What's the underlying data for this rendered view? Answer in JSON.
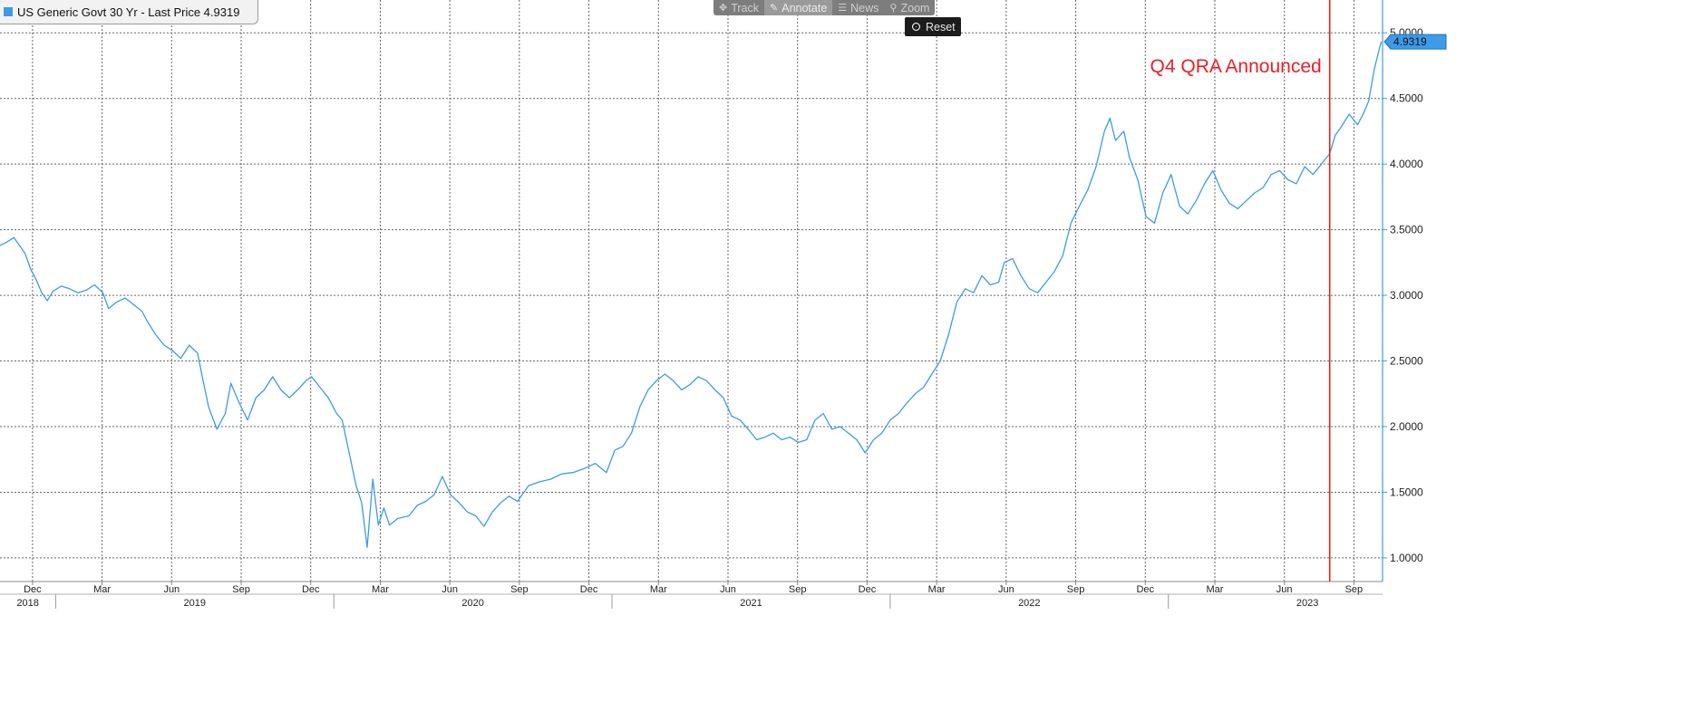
{
  "legend": {
    "label": "US Generic Govt 30 Yr - Last Price 4.9319",
    "swatch_color": "#3d9be8"
  },
  "toolbar": {
    "track_label": "Track",
    "annotate_label": "Annotate",
    "news_label": "News",
    "zoom_label": "Zoom",
    "reset_label": "Reset"
  },
  "annotation": {
    "text": "Q4 QRA Announced",
    "color": "#ee1c25",
    "date": "2023.58"
  },
  "last_price_tag": "4.9319",
  "colors": {
    "line": "#3d9be8",
    "marker": "#e2231a",
    "grid": "#666666"
  },
  "chart_data": {
    "type": "line",
    "title": "US Generic Govt 30 Yr",
    "xlabel": "",
    "ylabel": "",
    "xlim": [
      2018.8,
      2023.77
    ],
    "ylim": [
      0.82,
      5.25
    ],
    "grid": true,
    "legend_position": "top-left",
    "y_ticks": [
      1.0,
      1.5,
      2.0,
      2.5,
      3.0,
      3.5,
      4.0,
      4.5,
      5.0
    ],
    "y_tick_labels": [
      "1.0000",
      "1.5000",
      "2.0000",
      "2.5000",
      "3.0000",
      "3.5000",
      "4.0000",
      "4.5000",
      "5.0000"
    ],
    "x_month_ticks": [
      {
        "t": 2018.917,
        "label": "Dec"
      },
      {
        "t": 2019.167,
        "label": "Mar"
      },
      {
        "t": 2019.417,
        "label": "Jun"
      },
      {
        "t": 2019.667,
        "label": "Sep"
      },
      {
        "t": 2019.917,
        "label": "Dec"
      },
      {
        "t": 2020.167,
        "label": "Mar"
      },
      {
        "t": 2020.417,
        "label": "Jun"
      },
      {
        "t": 2020.667,
        "label": "Sep"
      },
      {
        "t": 2020.917,
        "label": "Dec"
      },
      {
        "t": 2021.167,
        "label": "Mar"
      },
      {
        "t": 2021.417,
        "label": "Jun"
      },
      {
        "t": 2021.667,
        "label": "Sep"
      },
      {
        "t": 2021.917,
        "label": "Dec"
      },
      {
        "t": 2022.167,
        "label": "Mar"
      },
      {
        "t": 2022.417,
        "label": "Jun"
      },
      {
        "t": 2022.667,
        "label": "Sep"
      },
      {
        "t": 2022.917,
        "label": "Dec"
      },
      {
        "t": 2023.167,
        "label": "Mar"
      },
      {
        "t": 2023.417,
        "label": "Jun"
      },
      {
        "t": 2023.667,
        "label": "Sep"
      }
    ],
    "x_year_labels": [
      {
        "t": 2018.9,
        "label": "2018"
      },
      {
        "t": 2019.5,
        "label": "2019"
      },
      {
        "t": 2020.5,
        "label": "2020"
      },
      {
        "t": 2021.5,
        "label": "2021"
      },
      {
        "t": 2022.5,
        "label": "2022"
      },
      {
        "t": 2023.5,
        "label": "2023"
      }
    ],
    "x_year_boundaries": [
      2019.0,
      2020.0,
      2021.0,
      2022.0,
      2023.0
    ],
    "series": [
      {
        "name": "US Generic Govt 30 Yr",
        "points": [
          [
            2018.8,
            3.38
          ],
          [
            2018.82,
            3.4
          ],
          [
            2018.85,
            3.44
          ],
          [
            2018.87,
            3.38
          ],
          [
            2018.89,
            3.32
          ],
          [
            2018.91,
            3.2
          ],
          [
            2018.93,
            3.12
          ],
          [
            2018.95,
            3.02
          ],
          [
            2018.97,
            2.96
          ],
          [
            2018.99,
            3.03
          ],
          [
            2019.02,
            3.07
          ],
          [
            2019.05,
            3.05
          ],
          [
            2019.08,
            3.02
          ],
          [
            2019.11,
            3.04
          ],
          [
            2019.14,
            3.08
          ],
          [
            2019.17,
            3.02
          ],
          [
            2019.19,
            2.9
          ],
          [
            2019.22,
            2.95
          ],
          [
            2019.25,
            2.98
          ],
          [
            2019.28,
            2.93
          ],
          [
            2019.31,
            2.88
          ],
          [
            2019.33,
            2.8
          ],
          [
            2019.36,
            2.7
          ],
          [
            2019.39,
            2.62
          ],
          [
            2019.42,
            2.58
          ],
          [
            2019.45,
            2.52
          ],
          [
            2019.48,
            2.62
          ],
          [
            2019.51,
            2.56
          ],
          [
            2019.53,
            2.35
          ],
          [
            2019.55,
            2.15
          ],
          [
            2019.58,
            1.98
          ],
          [
            2019.61,
            2.1
          ],
          [
            2019.63,
            2.33
          ],
          [
            2019.66,
            2.18
          ],
          [
            2019.69,
            2.05
          ],
          [
            2019.72,
            2.22
          ],
          [
            2019.75,
            2.28
          ],
          [
            2019.78,
            2.38
          ],
          [
            2019.81,
            2.28
          ],
          [
            2019.84,
            2.22
          ],
          [
            2019.87,
            2.28
          ],
          [
            2019.9,
            2.35
          ],
          [
            2019.92,
            2.38
          ],
          [
            2019.95,
            2.3
          ],
          [
            2019.98,
            2.22
          ],
          [
            2020.01,
            2.1
          ],
          [
            2020.03,
            2.05
          ],
          [
            2020.05,
            1.85
          ],
          [
            2020.08,
            1.55
          ],
          [
            2020.1,
            1.42
          ],
          [
            2020.12,
            1.08
          ],
          [
            2020.14,
            1.6
          ],
          [
            2020.16,
            1.25
          ],
          [
            2020.18,
            1.38
          ],
          [
            2020.2,
            1.25
          ],
          [
            2020.23,
            1.3
          ],
          [
            2020.27,
            1.32
          ],
          [
            2020.3,
            1.4
          ],
          [
            2020.33,
            1.43
          ],
          [
            2020.36,
            1.48
          ],
          [
            2020.39,
            1.62
          ],
          [
            2020.42,
            1.48
          ],
          [
            2020.45,
            1.42
          ],
          [
            2020.48,
            1.35
          ],
          [
            2020.51,
            1.32
          ],
          [
            2020.54,
            1.24
          ],
          [
            2020.57,
            1.35
          ],
          [
            2020.6,
            1.42
          ],
          [
            2020.63,
            1.47
          ],
          [
            2020.66,
            1.43
          ],
          [
            2020.7,
            1.55
          ],
          [
            2020.74,
            1.58
          ],
          [
            2020.78,
            1.6
          ],
          [
            2020.82,
            1.64
          ],
          [
            2020.86,
            1.65
          ],
          [
            2020.9,
            1.68
          ],
          [
            2020.94,
            1.72
          ],
          [
            2020.98,
            1.65
          ],
          [
            2021.01,
            1.82
          ],
          [
            2021.04,
            1.85
          ],
          [
            2021.07,
            1.95
          ],
          [
            2021.1,
            2.15
          ],
          [
            2021.13,
            2.28
          ],
          [
            2021.16,
            2.35
          ],
          [
            2021.19,
            2.4
          ],
          [
            2021.22,
            2.35
          ],
          [
            2021.25,
            2.28
          ],
          [
            2021.28,
            2.32
          ],
          [
            2021.31,
            2.38
          ],
          [
            2021.34,
            2.35
          ],
          [
            2021.37,
            2.28
          ],
          [
            2021.4,
            2.22
          ],
          [
            2021.43,
            2.08
          ],
          [
            2021.46,
            2.05
          ],
          [
            2021.49,
            1.98
          ],
          [
            2021.52,
            1.9
          ],
          [
            2021.55,
            1.92
          ],
          [
            2021.58,
            1.95
          ],
          [
            2021.61,
            1.9
          ],
          [
            2021.64,
            1.92
          ],
          [
            2021.67,
            1.88
          ],
          [
            2021.7,
            1.9
          ],
          [
            2021.73,
            2.05
          ],
          [
            2021.76,
            2.1
          ],
          [
            2021.79,
            1.98
          ],
          [
            2021.82,
            2.0
          ],
          [
            2021.85,
            1.95
          ],
          [
            2021.88,
            1.9
          ],
          [
            2021.91,
            1.8
          ],
          [
            2021.94,
            1.9
          ],
          [
            2021.97,
            1.95
          ],
          [
            2022.0,
            2.05
          ],
          [
            2022.03,
            2.1
          ],
          [
            2022.06,
            2.18
          ],
          [
            2022.09,
            2.25
          ],
          [
            2022.12,
            2.3
          ],
          [
            2022.15,
            2.4
          ],
          [
            2022.18,
            2.5
          ],
          [
            2022.21,
            2.7
          ],
          [
            2022.24,
            2.95
          ],
          [
            2022.27,
            3.05
          ],
          [
            2022.3,
            3.02
          ],
          [
            2022.33,
            3.15
          ],
          [
            2022.36,
            3.08
          ],
          [
            2022.39,
            3.1
          ],
          [
            2022.41,
            3.25
          ],
          [
            2022.44,
            3.28
          ],
          [
            2022.47,
            3.15
          ],
          [
            2022.5,
            3.05
          ],
          [
            2022.53,
            3.02
          ],
          [
            2022.56,
            3.1
          ],
          [
            2022.59,
            3.18
          ],
          [
            2022.62,
            3.3
          ],
          [
            2022.65,
            3.55
          ],
          [
            2022.68,
            3.68
          ],
          [
            2022.71,
            3.8
          ],
          [
            2022.74,
            3.98
          ],
          [
            2022.77,
            4.25
          ],
          [
            2022.79,
            4.35
          ],
          [
            2022.81,
            4.18
          ],
          [
            2022.84,
            4.25
          ],
          [
            2022.86,
            4.05
          ],
          [
            2022.89,
            3.88
          ],
          [
            2022.92,
            3.6
          ],
          [
            2022.95,
            3.55
          ],
          [
            2022.98,
            3.78
          ],
          [
            2023.01,
            3.92
          ],
          [
            2023.04,
            3.68
          ],
          [
            2023.07,
            3.62
          ],
          [
            2023.1,
            3.72
          ],
          [
            2023.13,
            3.85
          ],
          [
            2023.16,
            3.95
          ],
          [
            2023.19,
            3.8
          ],
          [
            2023.22,
            3.7
          ],
          [
            2023.25,
            3.66
          ],
          [
            2023.28,
            3.72
          ],
          [
            2023.31,
            3.78
          ],
          [
            2023.34,
            3.82
          ],
          [
            2023.37,
            3.92
          ],
          [
            2023.4,
            3.95
          ],
          [
            2023.43,
            3.88
          ],
          [
            2023.46,
            3.85
          ],
          [
            2023.49,
            3.98
          ],
          [
            2023.52,
            3.92
          ],
          [
            2023.55,
            4.0
          ],
          [
            2023.58,
            4.08
          ],
          [
            2023.6,
            4.22
          ],
          [
            2023.62,
            4.28
          ],
          [
            2023.65,
            4.38
          ],
          [
            2023.68,
            4.3
          ],
          [
            2023.7,
            4.38
          ],
          [
            2023.72,
            4.48
          ],
          [
            2023.74,
            4.72
          ],
          [
            2023.755,
            4.85
          ],
          [
            2023.765,
            4.9319
          ]
        ]
      }
    ]
  }
}
